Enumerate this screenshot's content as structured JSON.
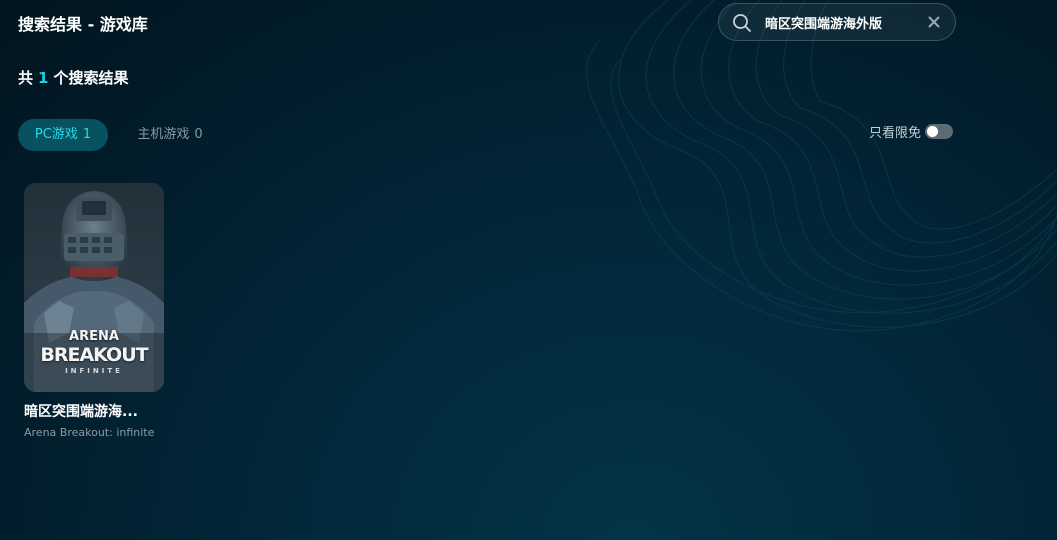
{
  "header": {
    "title": "搜索结果 - 游戏库"
  },
  "search": {
    "value": "暗区突围端游海外版",
    "search_icon": "search-icon",
    "clear_icon": "close-icon"
  },
  "results": {
    "prefix": "共",
    "count": "1",
    "suffix": "个搜索结果"
  },
  "tabs": [
    {
      "label": "PC游戏",
      "count": "1",
      "active": true
    },
    {
      "label": "主机游戏",
      "count": "0",
      "active": false
    }
  ],
  "filter": {
    "free_only_label": "只看限免",
    "free_only_enabled": false
  },
  "games": [
    {
      "title": "暗区突围端游海...",
      "subtitle": "Arena Breakout: infinite",
      "cover_logo": {
        "line1": "ARENA",
        "line2": "BREAKOUT",
        "line3": "INFINITE"
      }
    }
  ],
  "colors": {
    "accent": "#1ed0e6",
    "tab_active_bg": "#07525e",
    "background": "#022638"
  }
}
